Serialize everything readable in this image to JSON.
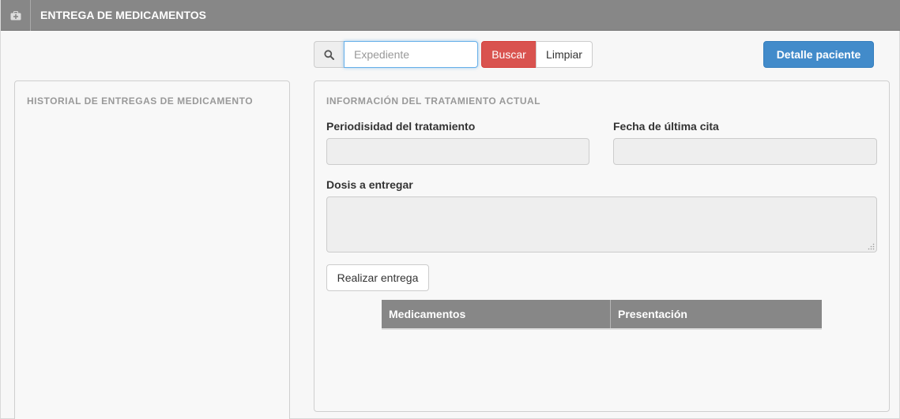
{
  "header": {
    "title": "ENTREGA DE MEDICAMENTOS",
    "icon": "medkit-icon"
  },
  "search": {
    "placeholder": "Expediente",
    "value": "",
    "icon": "search-icon",
    "buscar_label": "Buscar",
    "limpiar_label": "Limpiar"
  },
  "actions": {
    "detalle_label": "Detalle paciente"
  },
  "history_panel": {
    "title": "HISTORIAL DE ENTREGAS DE MEDICAMENTO"
  },
  "treatment_panel": {
    "title": "INFORMACIÓN DEL TRATAMIENTO ACTUAL",
    "periodicity_label": "Periodisidad del tratamiento",
    "periodicity_value": "",
    "last_appointment_label": "Fecha de última cita",
    "last_appointment_value": "",
    "dose_label": "Dosis a entregar",
    "dose_value": "",
    "submit_label": "Realizar entrega"
  },
  "table": {
    "columns": [
      "Medicamentos",
      "Presentación"
    ],
    "rows": []
  },
  "colors": {
    "header_bg": "#878787",
    "danger": "#d9534f",
    "primary": "#428bca"
  }
}
